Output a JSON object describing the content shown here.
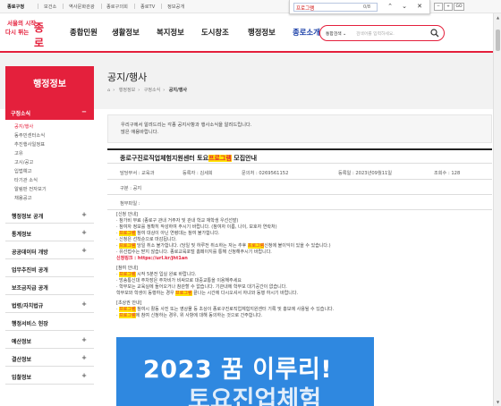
{
  "topbar": {
    "links": [
      "종로구청",
      "보건소",
      "역사문화관광",
      "종로구의회",
      "종로TV",
      "정보공개"
    ],
    "buttons": [
      "−",
      "+",
      "GO"
    ]
  },
  "findbar": {
    "query": "프로그램",
    "count": "0/8",
    "prev": "⌃",
    "next": "⌄",
    "close": "✕"
  },
  "logo": {
    "line1": "서울의 시작",
    "line2": "다시 뛰는",
    "brand": "종로"
  },
  "gnb": [
    "종합민원",
    "생활정보",
    "복지정보",
    "도시창조",
    "행정정보",
    "종로소개"
  ],
  "search": {
    "select": "통합검색 ⌄",
    "placeholder": "검색어를 입력하세요."
  },
  "lnb": {
    "head": "행정정보",
    "section": "구정소식",
    "section_toggle": "−",
    "subs": [
      "공지/행사",
      "동주민센터소식",
      "추진행사일정표",
      "고유",
      "고시/공고",
      "입법예고",
      "타기관 소식",
      "알림판 전자보기",
      "채용공고"
    ],
    "groups": [
      "행정정보 공개",
      "통계정보",
      "공공데이터 개방",
      "업무추진비 공개",
      "보조금지급 공개",
      "법령/자치법규",
      "행정서비스 헌장",
      "예산정보",
      "결산정보",
      "입찰정보"
    ],
    "toggle": "+"
  },
  "page": {
    "title": "공지/행사",
    "breadcrumb": [
      "⌂",
      "행정정보",
      "구정소식",
      "공지/행사"
    ],
    "intro_line1": "우리구에서 알려드리는 각종 공지사항과 행사소식을 알려드립니다.",
    "intro_line2": "많은 애용바랍니다."
  },
  "post": {
    "title_pre": "종로구진로직업체험지원센터 토요",
    "title_hl": "프로그램",
    "title_post": " 모집안내",
    "dept": "담당부서 : 교육과",
    "author": "등록자 : 김세희",
    "phone": "문의처 : 0269561152",
    "date": "등록일 : 2023년09월11일",
    "views": "조회수 : 128",
    "category": "구분 : 공지",
    "attach": "첨부파일 :",
    "body": [
      "[신청 안내]",
      "· 참가비 무료 (종로구 관내 거주자 및 관내 학교 재학생 우선선발)",
      "· 참여자 정보를 정확히 작성하여 주시기 바랍니다. (참여자 이름, 나이, 보호자 연락처)",
      "· 프로그램 참여 대상이 아닌 연령대는 참여 불가합니다.",
      "· 신청은 선착순으로 마감됩니다.",
      "· 프로그램 당일 취소 불가합니다. (당일 및 하루전 취소하는 자는 추후 프로그램신청에 불이익이 있을 수 있습니다.)",
      "· 유선접수는 받지 않습니다. 종로교육포털 홈페이지를 통해 신청해주시기 바랍니다.",
      "신청링크 : https://url.kr/jht1an",
      "[참여 안내]",
      "· 프로그램 시작 5분전 입실 완료 바랍니다.",
      "· 방송통신대 주차장은 주차비가 비싸므로 대중교통을 이용해주세요",
      "· 학부모는 교육실에 들어오거나 참관할 수 없습니다. 기관내에 학부모 대기공간이 없습니다.",
      "  학부모와 학생이 동행하는 경우 프로그램 끝나는 시간에 다시오셔서 자녀와 동행 하시기 바랍니다.",
      "[초상권 안내]",
      "· 프로그램 참여시 활동 사진 또는 영상물 등 초상이 종로구진로직업체험지원센터 기록 및 홍보에 사용될 수 있습니다.",
      "· 프로그램에 참여 신청하는 경우, 위 사항에 대해 동의하는 것으로 간주합니다."
    ],
    "poster_line1": "2023 꿈 이루리!",
    "poster_line2": "토요진업체험"
  },
  "colors": {
    "accent": "#e4203c",
    "highlight": "#ffe400",
    "nav_active": "#1a3fa8",
    "poster": "#2f88e0"
  }
}
